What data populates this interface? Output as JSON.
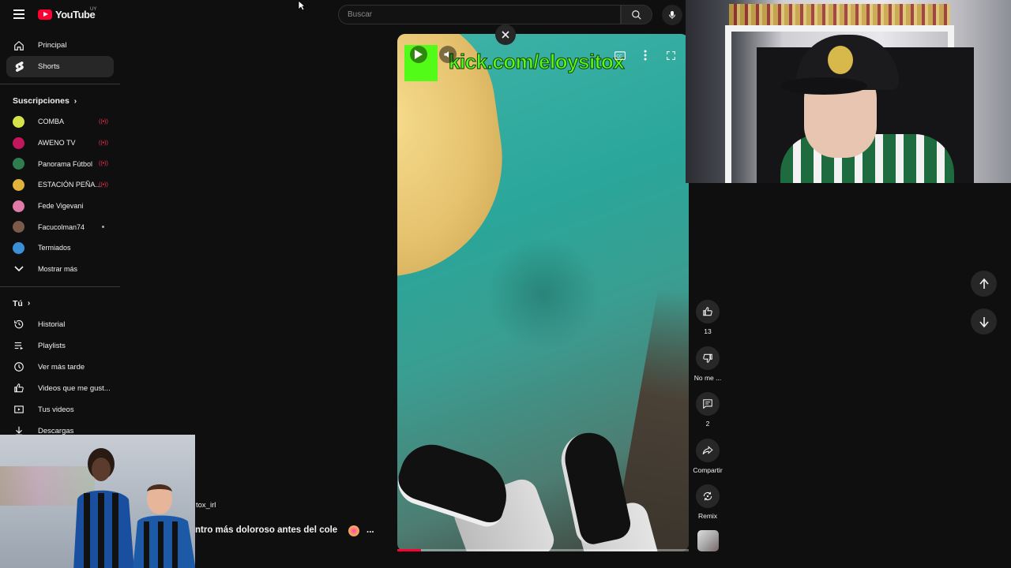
{
  "header": {
    "logo_text": "YouTube",
    "logo_country": "UY",
    "search_placeholder": "Buscar"
  },
  "sidebar": {
    "main": [
      {
        "label": "Principal",
        "icon": "home-icon"
      },
      {
        "label": "Shorts",
        "icon": "shorts-icon",
        "active": true
      }
    ],
    "subscriptions_title": "Suscripciones",
    "subscriptions": [
      {
        "label": "COMBA",
        "avatar_color": "#d6e24a",
        "status": "live"
      },
      {
        "label": "AWENO TV",
        "avatar_color": "#c2185b",
        "status": "live"
      },
      {
        "label": "Panorama Fútbol",
        "avatar_color": "#2e7d4f",
        "status": "live"
      },
      {
        "label": "ESTACIÓN PEÑA...",
        "avatar_color": "#e0b43a",
        "status": "live"
      },
      {
        "label": "Fede Vigevani",
        "avatar_color": "#e07aa6",
        "status": "none"
      },
      {
        "label": "Facucolman74",
        "avatar_color": "#7b5a4a",
        "status": "new"
      },
      {
        "label": "Termiados",
        "avatar_color": "#3a8fd6",
        "status": "none"
      }
    ],
    "show_more": "Mostrar más",
    "you_title": "Tú",
    "you_items": [
      {
        "label": "Historial",
        "icon": "history-icon"
      },
      {
        "label": "Playlists",
        "icon": "playlists-icon"
      },
      {
        "label": "Ver más tarde",
        "icon": "watch-later-icon"
      },
      {
        "label": "Videos que me gust...",
        "icon": "liked-videos-icon"
      },
      {
        "label": "Tus videos",
        "icon": "your-videos-icon"
      },
      {
        "label": "Descargas",
        "icon": "downloads-icon"
      }
    ]
  },
  "short": {
    "overlay_text": "kick.com/eloysitox",
    "channel_fragment": "tox_irl",
    "title_fragment": "ntro más doloroso antes del cole",
    "title_more": "...",
    "progress": 0.08,
    "actions": {
      "likes": "13",
      "dislike_label": "No me ...",
      "comments": "2",
      "share_label": "Compartir",
      "remix_label": "Remix"
    }
  },
  "colors": {
    "background": "#0f0f0f",
    "brand_red": "#ff0033",
    "kick_green": "#53fc18",
    "live_red": "#ff3355"
  }
}
